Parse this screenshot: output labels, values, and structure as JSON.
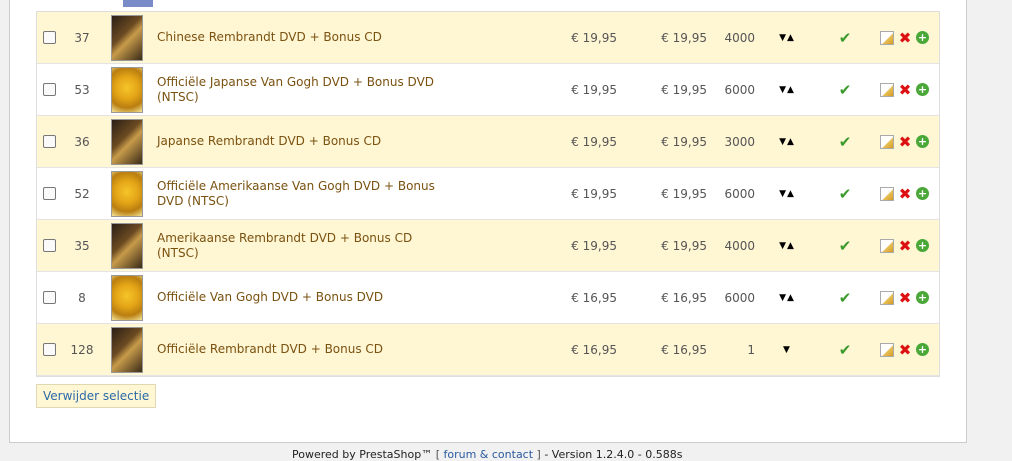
{
  "table": {
    "rows": [
      {
        "id": "37",
        "name": "Chinese Rembrandt DVD + Bonus CD",
        "thumb": "rembrandt",
        "price_excl": "€ 19,95",
        "price_incl": "€ 19,95",
        "qty": "4000",
        "pos": "▼▲"
      },
      {
        "id": "53",
        "name": "Officiële Japanse Van Gogh DVD + Bonus DVD (NTSC)",
        "thumb": "vangogh",
        "price_excl": "€ 19,95",
        "price_incl": "€ 19,95",
        "qty": "6000",
        "pos": "▼▲"
      },
      {
        "id": "36",
        "name": "Japanse Rembrandt DVD + Bonus CD",
        "thumb": "rembrandt",
        "price_excl": "€ 19,95",
        "price_incl": "€ 19,95",
        "qty": "3000",
        "pos": "▼▲"
      },
      {
        "id": "52",
        "name": "Officiële Amerikaanse Van Gogh DVD + Bonus DVD (NTSC)",
        "thumb": "vangogh",
        "price_excl": "€ 19,95",
        "price_incl": "€ 19,95",
        "qty": "6000",
        "pos": "▼▲"
      },
      {
        "id": "35",
        "name": "Amerikaanse Rembrandt DVD + Bonus CD (NTSC)",
        "thumb": "rembrandt",
        "price_excl": "€ 19,95",
        "price_incl": "€ 19,95",
        "qty": "4000",
        "pos": "▼▲"
      },
      {
        "id": "8",
        "name": "Officiële Van Gogh DVD + Bonus DVD",
        "thumb": "vangogh",
        "price_excl": "€ 16,95",
        "price_incl": "€ 16,95",
        "qty": "6000",
        "pos": "▼▲"
      },
      {
        "id": "128",
        "name": "Officiële Rembrandt DVD + Bonus CD",
        "thumb": "rembrandt",
        "price_excl": "€ 16,95",
        "price_incl": "€ 16,95",
        "qty": "1",
        "pos": "▼"
      }
    ],
    "icons": {
      "active": "check-icon",
      "edit": "edit-icon",
      "delete": "delete-icon",
      "add": "add-icon"
    }
  },
  "bulk": {
    "delete_label": "Verwijder selectie"
  },
  "footer": {
    "powered": "Powered by PrestaShop™",
    "bracket_open": "[",
    "link": "forum & contact",
    "bracket_close": "]",
    "version": "- Version 1.2.4.0 - 0.588s"
  },
  "colors": {
    "row_alt": "#fff6d4",
    "link": "#2a6aa8",
    "name": "#7a5210",
    "check": "#3a9a2a",
    "delete": "#dd1111"
  }
}
